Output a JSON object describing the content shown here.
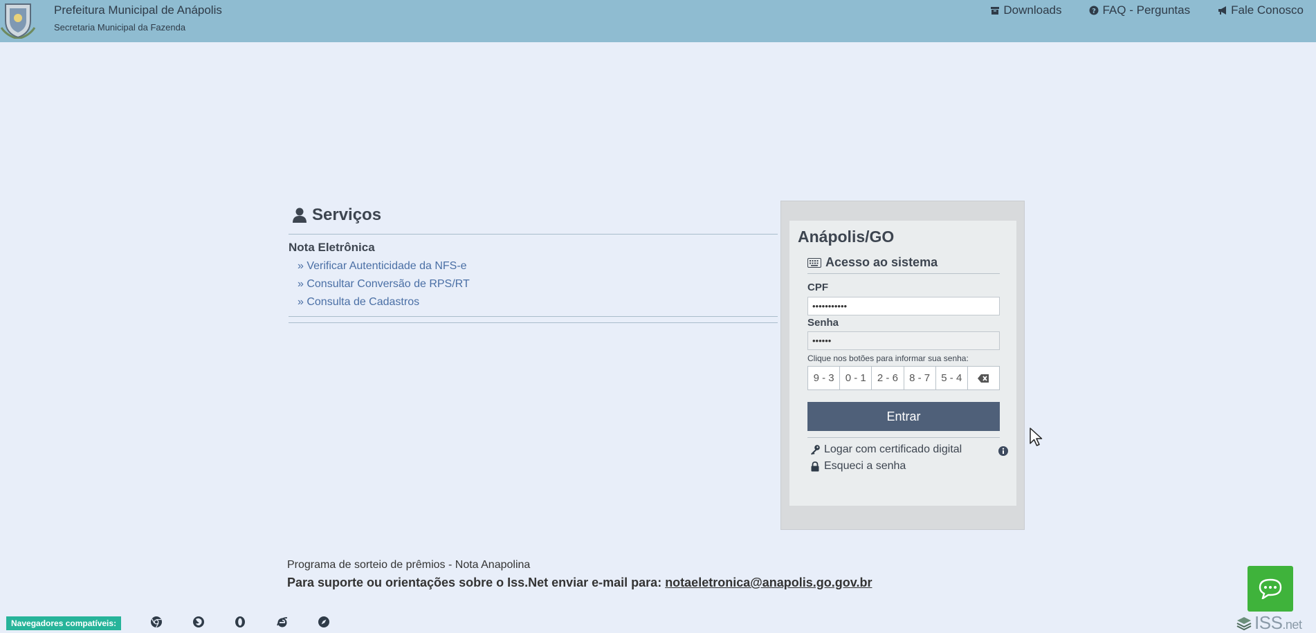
{
  "header": {
    "title": "Prefeitura Municipal de Anápolis",
    "subtitle": "Secretaria Municipal da Fazenda",
    "logo_icon": "city-coat-of-arms-icon",
    "nav": [
      {
        "label": "Downloads",
        "icon": "box-icon"
      },
      {
        "label": "FAQ - Perguntas",
        "icon": "question-circle-icon"
      },
      {
        "label": "Fale Conosco",
        "icon": "bullhorn-icon"
      }
    ]
  },
  "services": {
    "title": "Serviços",
    "icon": "user-icon",
    "section_title": "Nota Eletrônica",
    "links": [
      "» Verificar Autenticidade da NFS-e",
      "» Consultar Conversão de RPS/RT",
      "» Consulta de Cadastros"
    ]
  },
  "login": {
    "city": "Anápolis/GO",
    "access_title": "Acesso ao sistema",
    "cpf_label": "CPF",
    "cpf_value": "•••••••••••",
    "password_label": "Senha",
    "password_value": "••••••",
    "keypad_hint": "Clique nos botões para informar sua senha:",
    "keypad": [
      "9 - 3",
      "0 - 1",
      "2 - 6",
      "8 - 7",
      "5 - 4"
    ],
    "enter_label": "Entrar",
    "cert_link": "Logar com certificado digital",
    "forgot_link": "Esqueci a senha"
  },
  "footer": {
    "line1": "Programa de sorteio de prêmios - Nota Anapolina",
    "line2_text": "Para suporte ou orientações sobre o Iss.Net enviar e-mail para: ",
    "email": "notaeletronica@anapolis.go.gov.br",
    "browsers_label": "Navegadores compatíveis:",
    "browsers": [
      "chrome-icon",
      "firefox-icon",
      "opera-icon",
      "ie-icon",
      "safari-icon"
    ],
    "brand": "ISS",
    "brand_suffix": ".net"
  },
  "colors": {
    "header_bg": "#8fbcd1",
    "page_bg": "#e8eef9",
    "enter_button": "#4f6079",
    "chat_button": "#3fb33b",
    "link": "#4a6fa5",
    "badge": "#27b49a"
  }
}
